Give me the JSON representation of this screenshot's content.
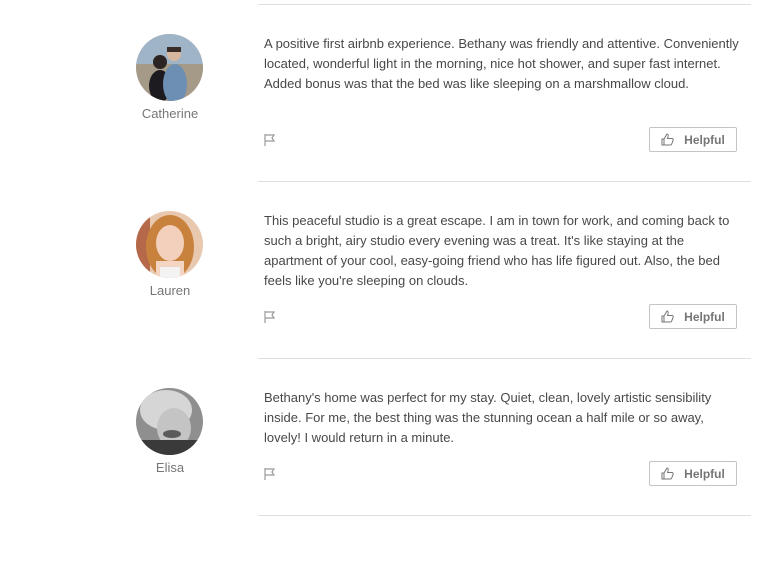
{
  "reviews": [
    {
      "name": "Catherine",
      "text": "A positive first airbnb experience. Bethany was friendly and attentive. Conveniently located, wonderful light in the morning, nice hot shower, and super fast internet. Added bonus was that the bed was like sleeping on a marshmallow cloud.",
      "helpful_label": "Helpful"
    },
    {
      "name": "Lauren",
      "text": "This peaceful studio is a great escape. I am in town for work, and coming back to such a bright, airy studio every evening was a treat. It's like staying at the apartment of your cool, easy-going friend who has life figured out. Also, the bed feels like you're sleeping on clouds.",
      "helpful_label": "Helpful"
    },
    {
      "name": "Elisa",
      "text": "Bethany's home was perfect for my stay. Quiet, clean, lovely artistic sensibility inside. For me, the best thing was the stunning ocean a half mile or so away, lovely! I would return in a minute.",
      "helpful_label": "Helpful"
    }
  ],
  "icons": {
    "flag": "flag-icon",
    "helpful": "thumbs-up-icon"
  }
}
